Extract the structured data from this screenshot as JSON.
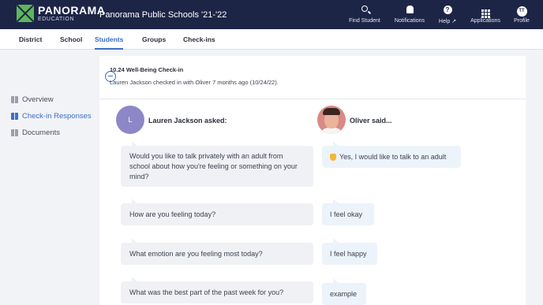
{
  "app": {
    "logo_name": "PANORAMA",
    "logo_sub": "EDUCATION",
    "title": "Panorama Public Schools '21-'22"
  },
  "topnav": [
    {
      "label": "Find Student",
      "icon": "search-icon"
    },
    {
      "label": "Notifications",
      "icon": "bell-icon"
    },
    {
      "label": "Help ↗",
      "icon": "help-icon",
      "glyph": "?"
    },
    {
      "label": "Applications",
      "icon": "grid-icon"
    },
    {
      "label": "Profile",
      "icon": "avatar-icon",
      "initials": "TT"
    }
  ],
  "tabs": [
    {
      "label": "District",
      "active": false
    },
    {
      "label": "School",
      "active": false
    },
    {
      "label": "Students",
      "active": true
    },
    {
      "label": "Groups",
      "active": false
    },
    {
      "label": "Check-ins",
      "active": false
    }
  ],
  "sidebar": [
    {
      "label": "Overview",
      "icon": "overview-icon",
      "active": false
    },
    {
      "label": "Check-in Responses",
      "icon": "book-icon",
      "active": true
    },
    {
      "label": "Documents",
      "icon": "document-icon",
      "active": false
    }
  ],
  "checkin": {
    "title": "10.24 Well-Being Check-in",
    "subtitle": "Lauren Jackson checked in with Oliver 7 months ago (10/24/22)."
  },
  "conversation": {
    "asker_initial": "L",
    "asker_label": "Lauren Jackson asked:",
    "student_label": "Oliver said...",
    "items": [
      {
        "question": "Would you like to talk privately with an adult from school about how you're feeling or something on your mind?",
        "answer": "Yes, I would like to talk to an adult",
        "answer_icon": "raised-hand-emoji"
      },
      {
        "question": "How are you feeling today?",
        "answer": "I feel okay"
      },
      {
        "question": "What emotion are you feeling most today?",
        "answer": "I feel happy"
      },
      {
        "question": "What was the best part of the past week for you?",
        "answer": "example"
      }
    ]
  },
  "colors": {
    "navbar": "#1d2547",
    "accent": "#3b6fc7",
    "brand_green": "#5cb85c",
    "avatar_purple": "#8d87c8"
  }
}
